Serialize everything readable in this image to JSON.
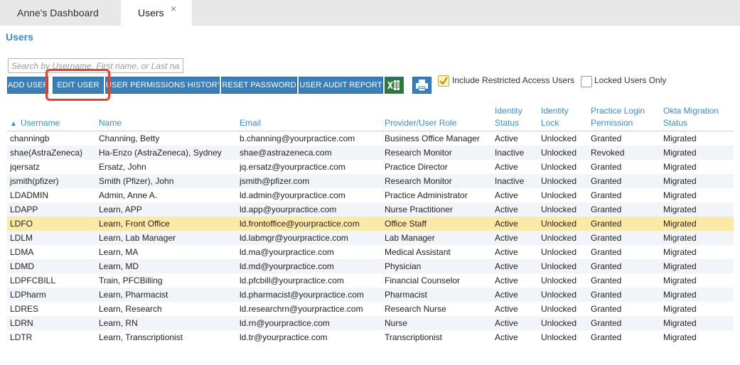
{
  "tabs": [
    {
      "label": "Anne's Dashboard"
    },
    {
      "label": "Users",
      "close": "×"
    }
  ],
  "page_title": "Users",
  "search": {
    "placeholder": "Search by Username, First name, or Last name",
    "value": ""
  },
  "toolbar": {
    "add_user": "ADD USER",
    "edit_user": "EDIT USER",
    "permissions_history": "USER PERMISSIONS HISTORY",
    "reset_password": "RESET PASSWORD",
    "audit_report": "USER AUDIT REPORT",
    "include_restricted_label": "Include Restricted Access Users",
    "include_restricted_checked": true,
    "locked_only_label": "Locked Users Only",
    "locked_only_checked": false
  },
  "columns": {
    "username": "Username",
    "name": "Name",
    "email": "Email",
    "role": "Provider/User Role",
    "status_1": "Identity",
    "status_2": "Status",
    "lock_1": "Identity",
    "lock_2": "Lock",
    "perm_1": "Practice Login",
    "perm_2": "Permission",
    "okta_1": "Okta Migration",
    "okta_2": "Status"
  },
  "rows": [
    {
      "username": "channingb",
      "name": "Channing, Betty",
      "email": "b.channing@yourpractice.com",
      "role": "Business Office Manager",
      "status": "Active",
      "lock": "Unlocked",
      "perm": "Granted",
      "okta": "Migrated"
    },
    {
      "username": "shae(AstraZeneca)",
      "name": "Ha-Enzo (AstraZeneca), Sydney",
      "email": "shae@astrazeneca.com",
      "role": "Research Monitor",
      "status": "Inactive",
      "lock": "Unlocked",
      "perm": "Revoked",
      "okta": "Migrated"
    },
    {
      "username": "jqersatz",
      "name": "Ersatz, John",
      "email": "jq.ersatz@yourpractice.com",
      "role": "Practice Director",
      "status": "Active",
      "lock": "Unlocked",
      "perm": "Granted",
      "okta": "Migrated"
    },
    {
      "username": "jsmith(pfizer)",
      "name": "Smith (Pfizer), John",
      "email": "jsmith@pfizer.com",
      "role": "Research Monitor",
      "status": "Inactive",
      "lock": "Unlocked",
      "perm": "Granted",
      "okta": "Migrated"
    },
    {
      "username": "LDADMIN",
      "name": "Admin, Anne A.",
      "email": "ld.admin@yourpractice.com",
      "role": "Practice Administrator",
      "status": "Active",
      "lock": "Unlocked",
      "perm": "Granted",
      "okta": "Migrated"
    },
    {
      "username": "LDAPP",
      "name": "Learn, APP",
      "email": "ld.app@yourpractice.com",
      "role": "Nurse Practitioner",
      "status": "Active",
      "lock": "Unlocked",
      "perm": "Granted",
      "okta": "Migrated"
    },
    {
      "username": "LDFO",
      "name": "Learn, Front Office",
      "email": "ld.frontoffice@yourpractice.com",
      "role": "Office Staff",
      "status": "Active",
      "lock": "Unlocked",
      "perm": "Granted",
      "okta": "Migrated"
    },
    {
      "username": "LDLM",
      "name": "Learn, Lab Manager",
      "email": "ld.labmgr@yourpractice.com",
      "role": "Lab Manager",
      "status": "Active",
      "lock": "Unlocked",
      "perm": "Granted",
      "okta": "Migrated"
    },
    {
      "username": "LDMA",
      "name": "Learn, MA",
      "email": "ld.ma@yourpractice.com",
      "role": "Medical Assistant",
      "status": "Active",
      "lock": "Unlocked",
      "perm": "Granted",
      "okta": "Migrated"
    },
    {
      "username": "LDMD",
      "name": "Learn, MD",
      "email": "ld.md@yourpractice.com",
      "role": "Physician",
      "status": "Active",
      "lock": "Unlocked",
      "perm": "Granted",
      "okta": "Migrated"
    },
    {
      "username": "LDPFCBILL",
      "name": "Train, PFCBilling",
      "email": "ld.pfcbill@yourpractice.com",
      "role": "Financial Counselor",
      "status": "Active",
      "lock": "Unlocked",
      "perm": "Granted",
      "okta": "Migrated"
    },
    {
      "username": "LDPharm",
      "name": "Learn, Pharmacist",
      "email": "ld.pharmacist@yourpractice.com",
      "role": "Pharmacist",
      "status": "Active",
      "lock": "Unlocked",
      "perm": "Granted",
      "okta": "Migrated"
    },
    {
      "username": "LDRES",
      "name": "Learn, Research",
      "email": "ld.researchrn@yourpractice.com",
      "role": "Research Nurse",
      "status": "Active",
      "lock": "Unlocked",
      "perm": "Granted",
      "okta": "Migrated"
    },
    {
      "username": "LDRN",
      "name": "Learn, RN",
      "email": "ld.rn@yourpractice.com",
      "role": "Nurse",
      "status": "Active",
      "lock": "Unlocked",
      "perm": "Granted",
      "okta": "Migrated"
    },
    {
      "username": "LDTR",
      "name": "Learn, Transcriptionist",
      "email": "ld.tr@yourpractice.com",
      "role": "Transcriptionist",
      "status": "Active",
      "lock": "Unlocked",
      "perm": "Granted",
      "okta": "Migrated"
    }
  ],
  "selected_row": 6,
  "colors": {
    "accent": "#3c8dcb",
    "button": "#3a7fb8",
    "selected_row": "#fbe9a8",
    "highlight_box": "#e0442f",
    "excel": "#2a7a3e"
  },
  "icons": {
    "sort": "sort-ascending-icon",
    "excel": "excel-export-icon",
    "print": "printer-icon",
    "close": "close-icon"
  }
}
